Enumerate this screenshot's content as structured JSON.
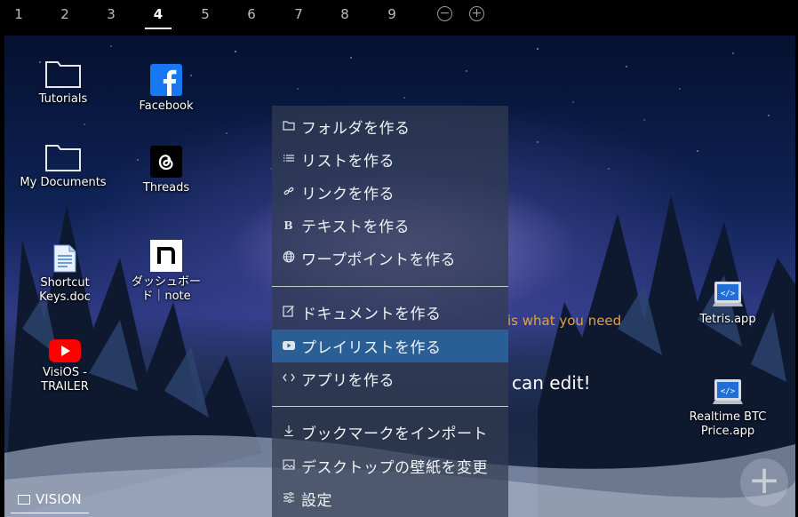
{
  "tabs": [
    "1",
    "2",
    "3",
    "4",
    "5",
    "6",
    "7",
    "8",
    "9"
  ],
  "active_tab": "4",
  "tab_controls": {
    "zoom_out": "−",
    "zoom_in": "+"
  },
  "desktop_icons": {
    "tutorials": "Tutorials",
    "facebook": "Facebook",
    "my_documents": "My Documents",
    "threads": "Threads",
    "shortcut_keys": "Shortcut Keys.doc",
    "dashboard_note": "ダッシュボード｜note",
    "visios_trailer": "VisiOS - TRAILER",
    "tetris": "Tetris.app",
    "btc_price": "Realtime BTC Price.app"
  },
  "background_text": {
    "line1_fragment": "is what you need",
    "line2_fragment": "can edit!"
  },
  "context_menu": {
    "items": [
      {
        "label": "フォルダを作る",
        "icon": "folder-icon"
      },
      {
        "label": "リストを作る",
        "icon": "list-icon"
      },
      {
        "label": "リンクを作る",
        "icon": "link-icon"
      },
      {
        "label": "テキストを作る",
        "icon": "text-bold-icon"
      },
      {
        "label": "ワープポイントを作る",
        "icon": "globe-icon"
      },
      {
        "label": "ドキュメントを作る",
        "icon": "edit-document-icon"
      },
      {
        "label": "プレイリストを作る",
        "icon": "youtube-icon"
      },
      {
        "label": "アプリを作る",
        "icon": "code-icon"
      },
      {
        "label": "ブックマークをインポート",
        "icon": "download-icon"
      },
      {
        "label": "デスクトップの壁紙を変更",
        "icon": "image-icon"
      },
      {
        "label": "設定",
        "icon": "sliders-icon"
      }
    ],
    "highlighted_index": 6
  },
  "workspace_label": "VISION",
  "add_button": "+",
  "colors": {
    "highlight": "#2a5f96",
    "accent_text": "#e2a23a",
    "facebook": "#1877f2",
    "youtube": "#ff0000"
  }
}
